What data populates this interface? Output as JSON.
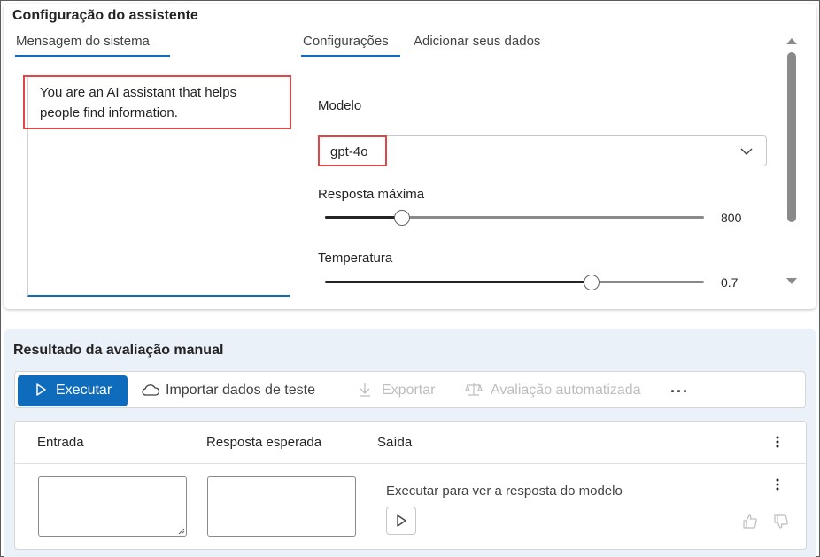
{
  "assistant_setup": {
    "title": "Configuração do assistente",
    "tabs": {
      "system_message": "Mensagem do sistema",
      "configurations": "Configurações",
      "add_data": "Adicionar seus dados"
    },
    "system_message_text": "You are an AI assistant that helps people find information.",
    "model": {
      "label": "Modelo",
      "selected": "gpt-4o"
    },
    "max_response": {
      "label": "Resposta máxima",
      "value": "800",
      "fraction": 0.2
    },
    "temperature": {
      "label": "Temperatura",
      "value": "0.7",
      "fraction": 0.7
    }
  },
  "manual_evaluation": {
    "title": "Resultado da avaliação manual",
    "toolbar": {
      "run": "Executar",
      "import": "Importar dados de teste",
      "export": "Exportar",
      "automated_eval": "Avaliação automatizada",
      "more": "···"
    },
    "table": {
      "columns": [
        "Entrada",
        "Resposta esperada",
        "Saída"
      ],
      "rows": [
        {
          "input": "",
          "expected": "",
          "output_hint": "Executar para ver a resposta do modelo"
        }
      ]
    }
  },
  "colors": {
    "accent": "#0f6cbd",
    "highlight": "#e04646",
    "panel_bg": "#eaf1f9"
  }
}
